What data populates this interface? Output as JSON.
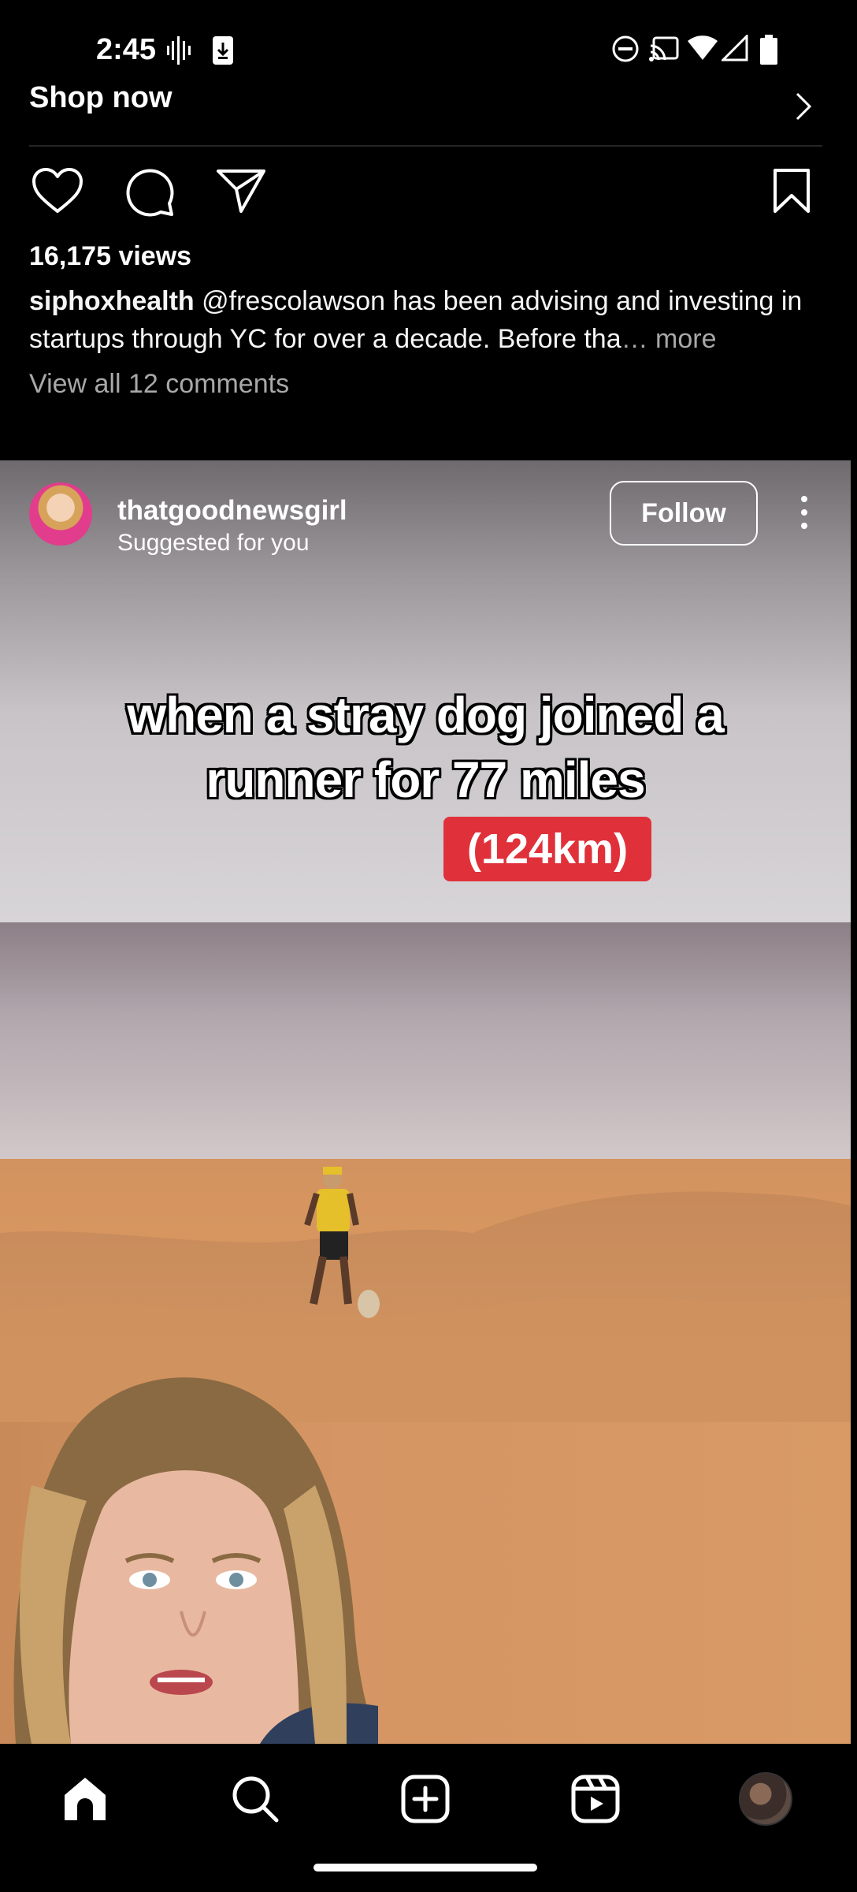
{
  "status_bar": {
    "time": "2:45"
  },
  "prev_post": {
    "shop_label": "Shop now",
    "views": "16,175 views",
    "caption_user": "siphoxhealth",
    "caption_text": " @frescolawson has been advising and investing in startups through YC for over a decade. Before tha",
    "caption_ellipsis": "…",
    "caption_more": " more",
    "comments_link": "View all 12 comments"
  },
  "post": {
    "username": "thatgoodnewsgirl",
    "subtitle": "Suggested for you",
    "follow_label": "Follow",
    "overlay_line1": "when a stray dog joined a",
    "overlay_line2": "runner for 77 miles",
    "badge": "(124km)"
  },
  "nav": {
    "items": [
      "home-icon",
      "search-icon",
      "create-icon",
      "reels-icon",
      "profile-avatar"
    ]
  },
  "colors": {
    "badge_red": "#e0313a",
    "follow_border": "#ffffff",
    "muted_text": "#a8a8a8"
  }
}
